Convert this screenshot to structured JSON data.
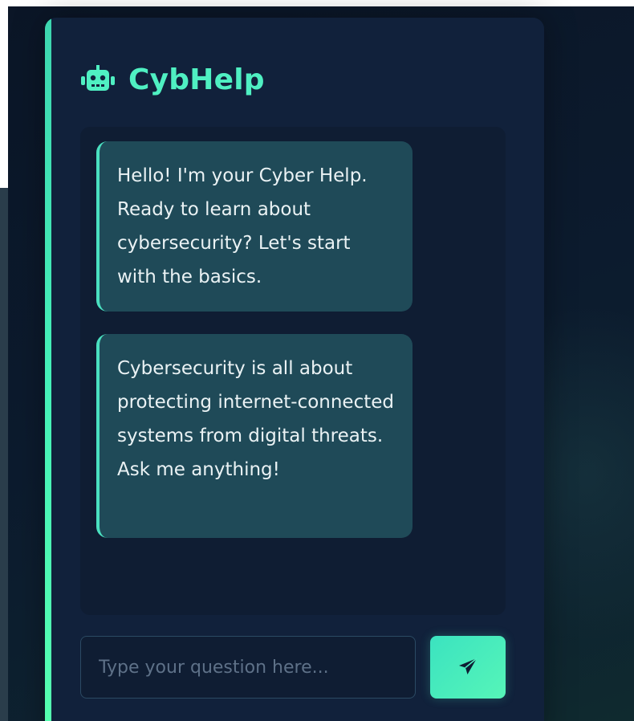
{
  "app": {
    "title": "CybHelp",
    "icon": "robot-icon"
  },
  "messages": [
    {
      "text": "Hello! I'm your Cyber Help. Ready to learn about cybersecurity? Let's start with the basics."
    },
    {
      "text": "Cybersecurity is all about protecting internet-connected systems from digital threats. Ask me anything!"
    }
  ],
  "input": {
    "placeholder": "Type your question here...",
    "value": ""
  },
  "send_button": {
    "icon": "send-paper-plane-icon"
  },
  "colors": {
    "accent": "#4ff0c2",
    "panel_bg": "#11213b",
    "bubble_bg": "#1f4a58",
    "page_bg": "#0c1a2c"
  }
}
